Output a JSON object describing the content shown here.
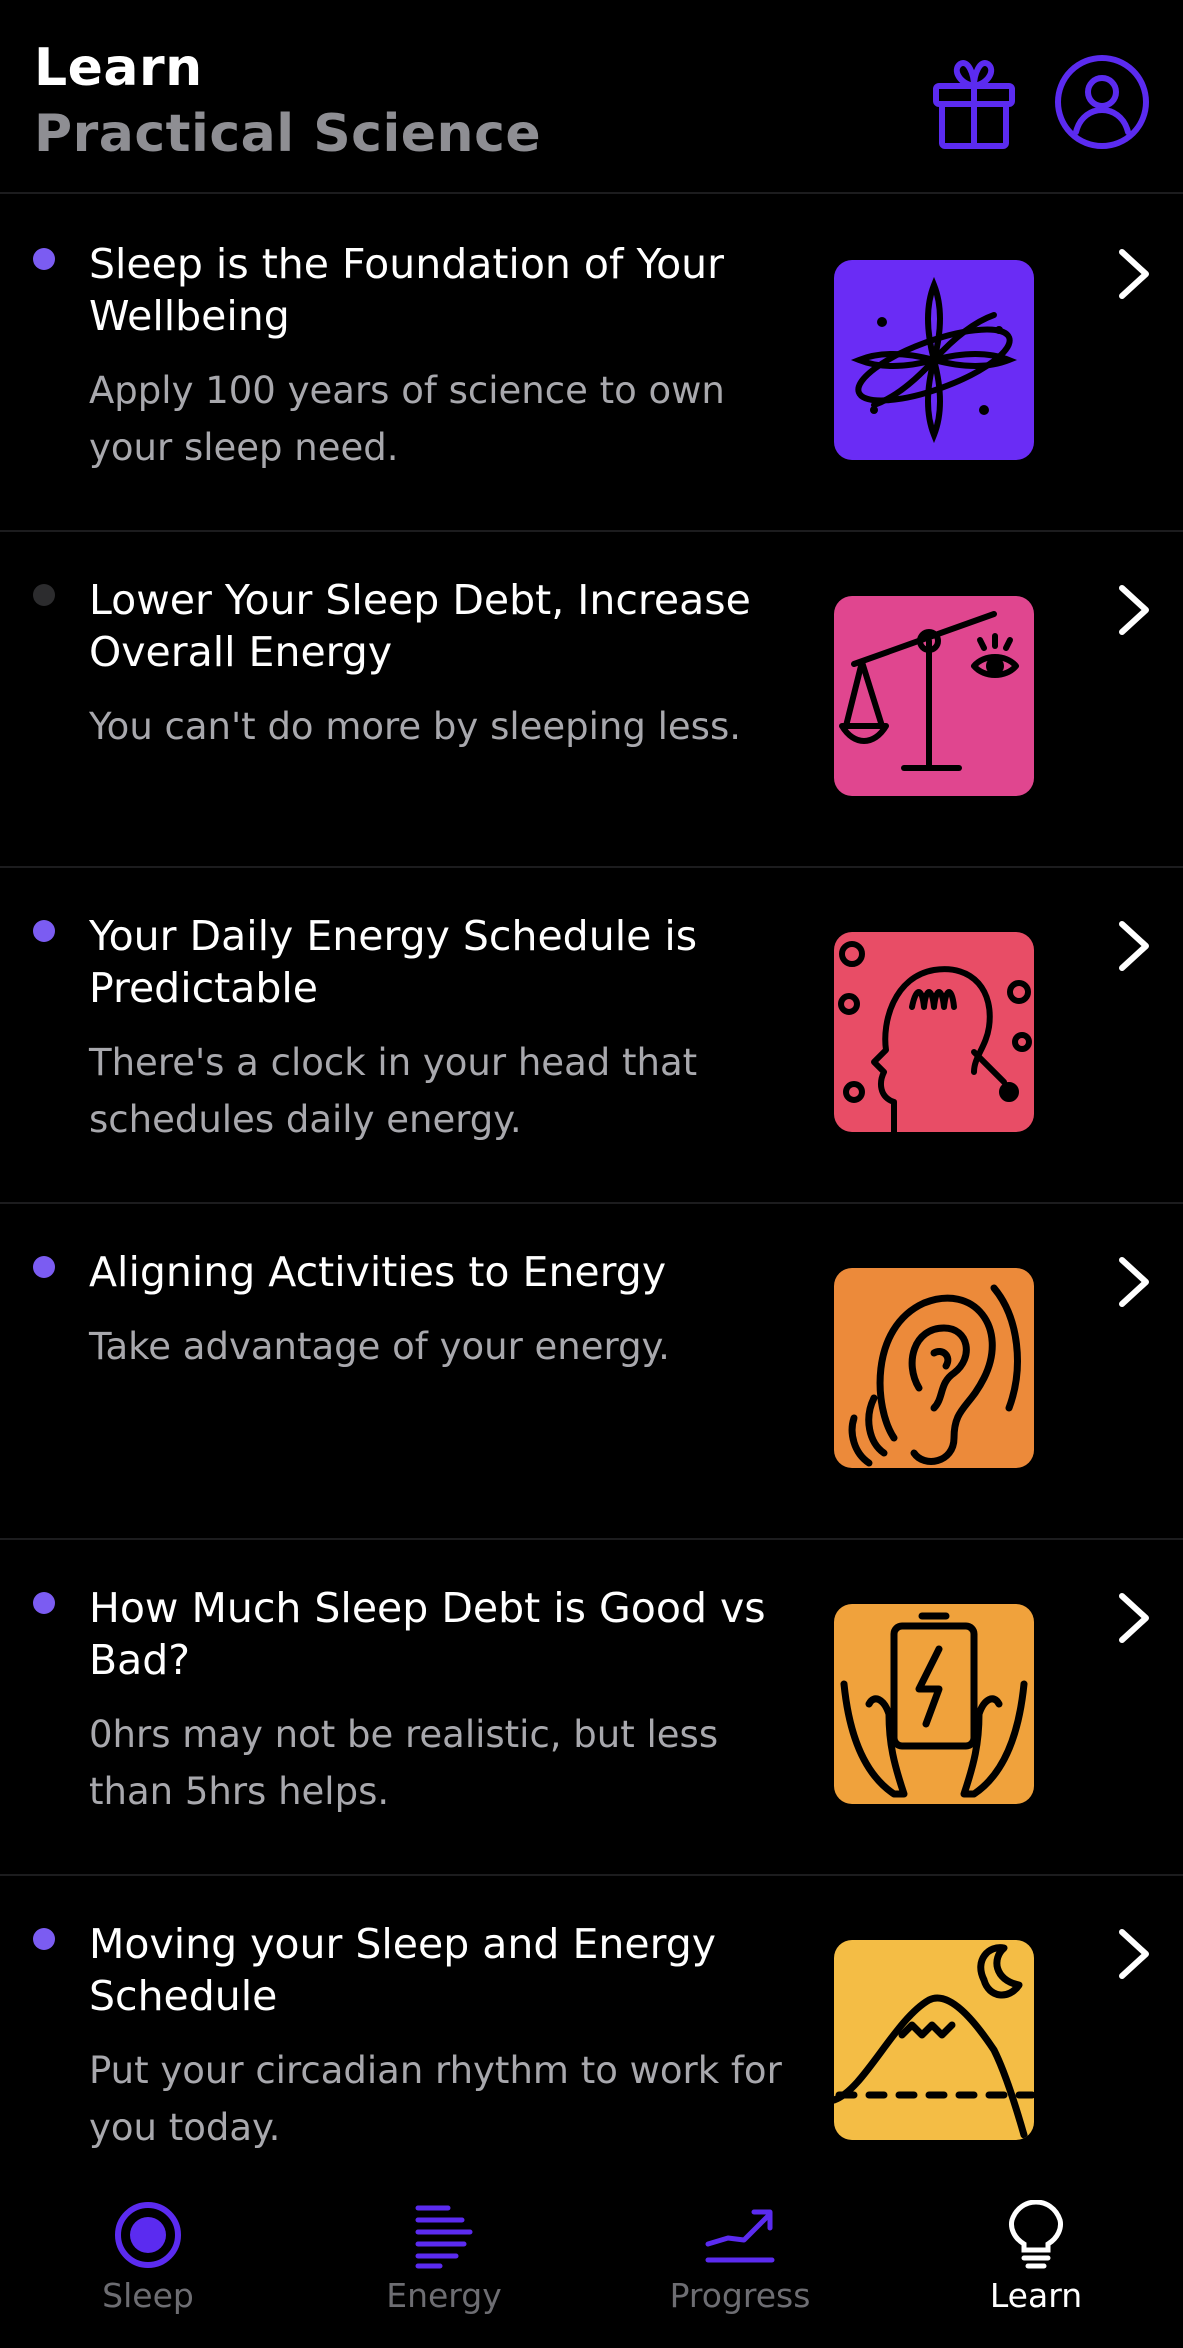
{
  "header": {
    "title": "Learn",
    "subtitle": "Practical Science",
    "gift_icon": "gift-icon",
    "profile_icon": "profile-icon"
  },
  "colors": {
    "accent": "#5b2bf0",
    "unread_dot": "#7b5cf2",
    "read_dot": "#2c2c2e"
  },
  "lessons": [
    {
      "title": "Sleep is the Foundation of Your Wellbeing",
      "description": "Apply 100 years of science to own your sleep need.",
      "unread": true,
      "thumb_color": "#6a2cf5",
      "thumb_icon": "sparkle-orbit-icon"
    },
    {
      "title": "Lower Your Sleep Debt, Increase Overall Energy",
      "description": "You can't do more by sleeping less.",
      "unread": false,
      "thumb_color": "#e0468f",
      "thumb_icon": "balance-scale-icon"
    },
    {
      "title": "Your Daily Energy Schedule is Predictable",
      "description": "There's a clock in your head that schedules daily energy.",
      "unread": true,
      "thumb_color": "#e84d66",
      "thumb_icon": "head-profile-icon"
    },
    {
      "title": "Aligning Activities to Energy",
      "description": "Take advantage of your energy.",
      "unread": true,
      "thumb_color": "#ec8a3a",
      "thumb_icon": "ear-icon"
    },
    {
      "title": "How Much Sleep Debt is Good vs Bad?",
      "description": "0hrs may not be realistic, but less than 5hrs helps.",
      "unread": true,
      "thumb_color": "#f0a23c",
      "thumb_icon": "battery-hands-icon"
    },
    {
      "title": "Moving your Sleep and Energy Schedule",
      "description": "Put your circadian rhythm to work for you today.",
      "unread": true,
      "thumb_color": "#f4bd45",
      "thumb_icon": "mountain-moon-icon"
    }
  ],
  "tabs": [
    {
      "label": "Sleep",
      "icon": "sleep-tab-icon",
      "active": false
    },
    {
      "label": "Energy",
      "icon": "energy-tab-icon",
      "active": false
    },
    {
      "label": "Progress",
      "icon": "progress-tab-icon",
      "active": false
    },
    {
      "label": "Learn",
      "icon": "lightbulb-icon",
      "active": true
    }
  ]
}
